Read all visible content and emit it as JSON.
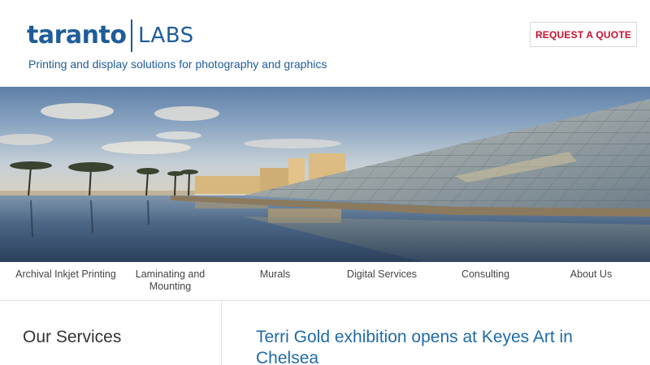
{
  "brand": {
    "name_main": "taranto",
    "name_sub": "LABS",
    "tagline": "Printing and display solutions for photography and graphics",
    "color": "#1f5c99"
  },
  "header": {
    "cta_label": "REQUEST A QUOTE",
    "cta_color": "#c8102e"
  },
  "nav": {
    "items": [
      {
        "label": "Archival Inkjet Printing"
      },
      {
        "label": "Laminating and Mounting"
      },
      {
        "label": "Murals"
      },
      {
        "label": "Digital Services"
      },
      {
        "label": "Consulting"
      },
      {
        "label": "About Us"
      }
    ]
  },
  "sidebar": {
    "title": "Our Services"
  },
  "main": {
    "article_title": "Terri Gold exhibition opens at Keyes Art in Chelsea",
    "link_color": "#1f6aa8"
  }
}
